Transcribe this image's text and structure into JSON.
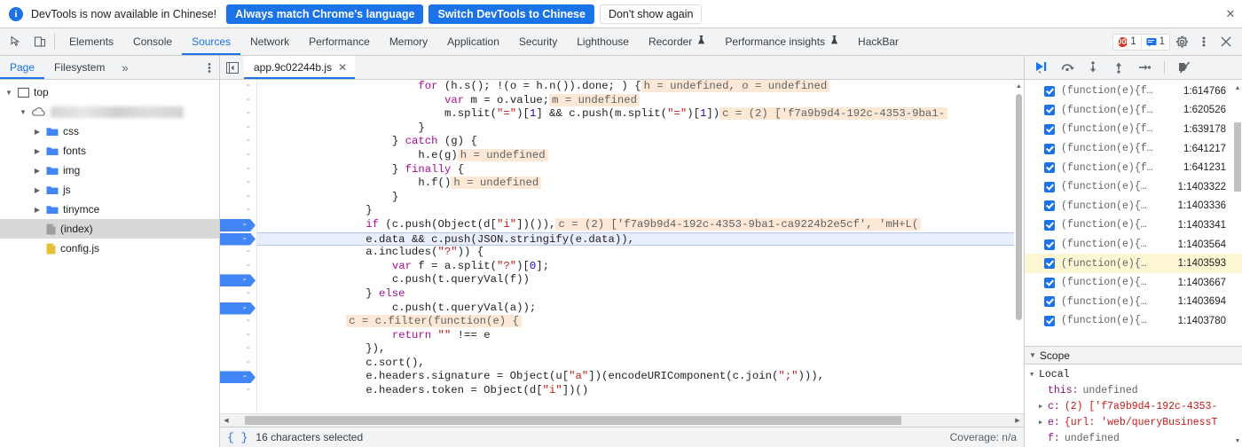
{
  "banner": {
    "icon": "info-icon",
    "message": "DevTools is now available in Chinese!",
    "btn_always": "Always match Chrome's language",
    "btn_switch": "Switch DevTools to Chinese",
    "btn_dismiss": "Don't show again",
    "close": "✕",
    "accent": "#1a73e8"
  },
  "toolbar": {
    "tabs": [
      {
        "label": "Elements",
        "active": false,
        "flask": false
      },
      {
        "label": "Console",
        "active": false,
        "flask": false
      },
      {
        "label": "Sources",
        "active": true,
        "flask": false
      },
      {
        "label": "Network",
        "active": false,
        "flask": false
      },
      {
        "label": "Performance",
        "active": false,
        "flask": false
      },
      {
        "label": "Memory",
        "active": false,
        "flask": false
      },
      {
        "label": "Application",
        "active": false,
        "flask": false
      },
      {
        "label": "Security",
        "active": false,
        "flask": false
      },
      {
        "label": "Lighthouse",
        "active": false,
        "flask": false
      },
      {
        "label": "Recorder",
        "active": false,
        "flask": true
      },
      {
        "label": "Performance insights",
        "active": false,
        "flask": true
      },
      {
        "label": "HackBar",
        "active": false,
        "flask": false
      }
    ],
    "error_count": "1",
    "message_count": "1",
    "settings_icon": "gear-icon",
    "more_icon": "more-vertical-icon",
    "close_icon": "close-icon",
    "inspect_icon": "inspect-icon",
    "device_icon": "device-toolbar-icon"
  },
  "navigator": {
    "tabs": [
      {
        "label": "Page",
        "active": true
      },
      {
        "label": "Filesystem",
        "active": false
      }
    ],
    "overflow": "»",
    "menu_icon": "more-vertical-icon",
    "tree": [
      {
        "label": "top",
        "depth": 0,
        "icon": "frame-icon",
        "twisty": "open",
        "selected": false
      },
      {
        "label": "",
        "depth": 1,
        "icon": "cloud-icon",
        "twisty": "open",
        "selected": false,
        "blurred": true
      },
      {
        "label": "css",
        "depth": 2,
        "icon": "folder-icon",
        "twisty": "closed",
        "selected": false
      },
      {
        "label": "fonts",
        "depth": 2,
        "icon": "folder-icon",
        "twisty": "closed",
        "selected": false
      },
      {
        "label": "img",
        "depth": 2,
        "icon": "folder-icon",
        "twisty": "closed",
        "selected": false
      },
      {
        "label": "js",
        "depth": 2,
        "icon": "folder-icon",
        "twisty": "closed",
        "selected": false
      },
      {
        "label": "tinymce",
        "depth": 2,
        "icon": "folder-icon",
        "twisty": "closed",
        "selected": false
      },
      {
        "label": "(index)",
        "depth": 2,
        "icon": "document-icon",
        "twisty": "none",
        "selected": true
      },
      {
        "label": "config.js",
        "depth": 2,
        "icon": "js-file-icon",
        "twisty": "none",
        "selected": false
      }
    ]
  },
  "editor": {
    "panel_toggle_icon": "show-navigator-icon",
    "tab_name": "app.9c02244b.js",
    "tab_close": "✕",
    "status_icon": "pretty-print-icon",
    "status_text": "16 characters selected",
    "coverage_text": "Coverage: n/a",
    "lines": [
      {
        "bp": false,
        "gnum": "-",
        "hl": "none"
      },
      {
        "bp": false,
        "gnum": "-",
        "hl": "none"
      },
      {
        "bp": false,
        "gnum": "-",
        "hl": "none"
      },
      {
        "bp": false,
        "gnum": "-",
        "hl": "none"
      },
      {
        "bp": false,
        "gnum": "-",
        "hl": "none"
      },
      {
        "bp": false,
        "gnum": "-",
        "hl": "none"
      },
      {
        "bp": false,
        "gnum": "-",
        "hl": "none"
      },
      {
        "bp": false,
        "gnum": "-",
        "hl": "none"
      },
      {
        "bp": false,
        "gnum": "-",
        "hl": "none"
      },
      {
        "bp": false,
        "gnum": "-",
        "hl": "none"
      },
      {
        "bp": true,
        "gnum": "-",
        "hl": "none"
      },
      {
        "bp": true,
        "gnum": "-",
        "hl": "exec"
      },
      {
        "bp": false,
        "gnum": "-",
        "hl": "none"
      },
      {
        "bp": false,
        "gnum": "-",
        "hl": "none"
      },
      {
        "bp": true,
        "gnum": "-",
        "hl": "none"
      },
      {
        "bp": false,
        "gnum": "-",
        "hl": "none"
      },
      {
        "bp": true,
        "gnum": "-",
        "hl": "none"
      },
      {
        "bp": false,
        "gnum": "-",
        "hl": "none"
      },
      {
        "bp": false,
        "gnum": "-",
        "hl": "none"
      },
      {
        "bp": false,
        "gnum": "-",
        "hl": "none"
      },
      {
        "bp": false,
        "gnum": "-",
        "hl": "none"
      },
      {
        "bp": true,
        "gnum": "-",
        "hl": "none"
      },
      {
        "bp": false,
        "gnum": "-",
        "hl": "none"
      }
    ],
    "code_text": [
      "                        for (h.s(); !(o = h.n()).done; ) {   h = undefined, o = undefined",
      "                            var m = o.value;   m = undefined",
      "                            m.split(\"=\")[1] && c.push(m.split(\"=\")[1])   c = (2) ['f7a9b9d4-192c-4353-9ba1-",
      "                        }",
      "                    } catch (g) {",
      "                        h.e(g)   h = undefined",
      "                    } finally {",
      "                        h.f()   h = undefined",
      "                    }",
      "                }",
      "                if (c.push(Object(d[\"i\"])()),   c = (2) ['f7a9b9d4-192c-4353-9ba1-ca9224b2e5cf', 'mH+L(",
      "                e.data && c.push(JSON.stringify(e.data)),",
      "                a.includes(\"?\")) {",
      "                    var f = a.split(\"?\")[0];",
      "                    c.push(t.queryVal(f))",
      "                } else",
      "                    c.push(t.queryVal(a));",
      "                c = c.filter(function(e) {",
      "                    return \"\" !== e",
      "                }),",
      "                c.sort(),",
      "                e.headers.signature = Object(u[\"a\"])(encodeURIComponent(c.join(\";\"))),",
      "                e.headers.token = Object(d[\"i\"])()"
    ]
  },
  "debugger": {
    "controls": [
      {
        "name": "resume-script-execution",
        "icon": "resume-icon"
      },
      {
        "name": "step-over-next-function-call",
        "icon": "step-over-icon"
      },
      {
        "name": "step-into-next-function-call",
        "icon": "step-into-icon"
      },
      {
        "name": "step-out-of-current-function",
        "icon": "step-out-icon"
      },
      {
        "name": "step",
        "icon": "step-icon"
      },
      {
        "name": "deactivate-breakpoints",
        "icon": "deactivate-breakpoints-icon"
      }
    ],
    "breakpoints": [
      {
        "name": "(function(e){f…",
        "loc": "1:614766",
        "checked": true,
        "active": false
      },
      {
        "name": "(function(e){f…",
        "loc": "1:620526",
        "checked": true,
        "active": false
      },
      {
        "name": "(function(e){f…",
        "loc": "1:639178",
        "checked": true,
        "active": false
      },
      {
        "name": "(function(e){f…",
        "loc": "1:641217",
        "checked": true,
        "active": false
      },
      {
        "name": "(function(e){f…",
        "loc": "1:641231",
        "checked": true,
        "active": false
      },
      {
        "name": "(function(e){…",
        "loc": "1:1403322",
        "checked": true,
        "active": false
      },
      {
        "name": "(function(e){…",
        "loc": "1:1403336",
        "checked": true,
        "active": false
      },
      {
        "name": "(function(e){…",
        "loc": "1:1403341",
        "checked": true,
        "active": false
      },
      {
        "name": "(function(e){…",
        "loc": "1:1403564",
        "checked": true,
        "active": false
      },
      {
        "name": "(function(e){…",
        "loc": "1:1403593",
        "checked": true,
        "active": true
      },
      {
        "name": "(function(e){…",
        "loc": "1:1403667",
        "checked": true,
        "active": false
      },
      {
        "name": "(function(e){…",
        "loc": "1:1403694",
        "checked": true,
        "active": false
      },
      {
        "name": "(function(e){…",
        "loc": "1:1403780",
        "checked": true,
        "active": false
      }
    ],
    "scope_title": "Scope",
    "scope": [
      {
        "twisty": "open",
        "key": "Local",
        "sep": "",
        "value": "",
        "depth": 0,
        "kind": "section"
      },
      {
        "twisty": "none",
        "key": "this",
        "sep": ":",
        "value": "undefined",
        "depth": 1,
        "kind": "plain"
      },
      {
        "twisty": "closed",
        "key": "c",
        "sep": ":",
        "value": "(2) ['f7a9b9d4-192c-4353-",
        "depth": 1,
        "kind": "obj"
      },
      {
        "twisty": "closed",
        "key": "e",
        "sep": ":",
        "value": "{url: 'web/queryBusinessT",
        "depth": 1,
        "kind": "obj"
      },
      {
        "twisty": "none",
        "key": "f",
        "sep": ":",
        "value": "undefined",
        "depth": 1,
        "kind": "plain"
      }
    ]
  }
}
